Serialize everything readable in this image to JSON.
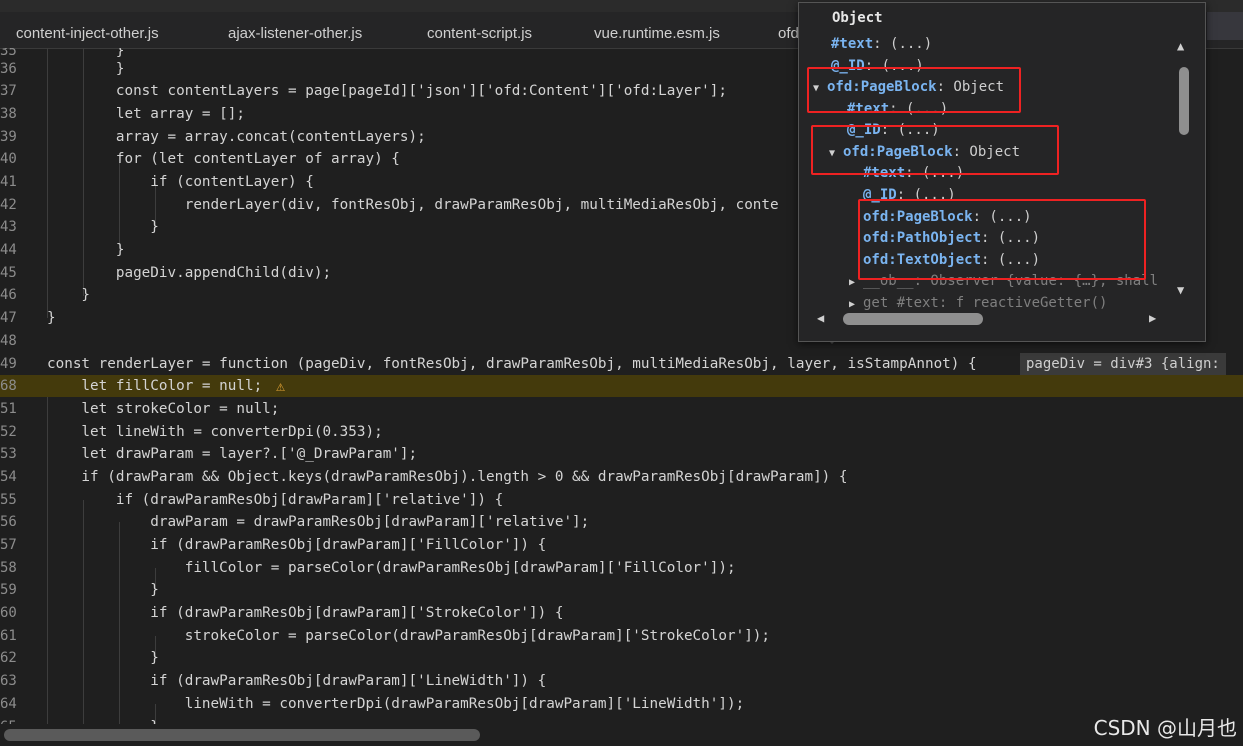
{
  "tabs": [
    {
      "label": "content-inject-other.js"
    },
    {
      "label": "ajax-listener-other.js"
    },
    {
      "label": "content-script.js"
    },
    {
      "label": "vue.runtime.esm.js"
    },
    {
      "label": "ofd"
    }
  ],
  "lines": [
    {
      "no": "35",
      "text": "        }"
    },
    {
      "no": "36",
      "text": "        }"
    },
    {
      "no": "37",
      "text": "        const contentLayers = page[pageId]['json']['ofd:Content']['ofd:Layer'];"
    },
    {
      "no": "38",
      "text": "        let array = [];"
    },
    {
      "no": "39",
      "text": "        array = array.concat(contentLayers);"
    },
    {
      "no": "40",
      "text": "        for (let contentLayer of array) {"
    },
    {
      "no": "41",
      "text": "            if (contentLayer) {"
    },
    {
      "no": "42",
      "text": "                renderLayer(div, fontResObj, drawParamResObj, multiMediaResObj, conte"
    },
    {
      "no": "43",
      "text": "            }"
    },
    {
      "no": "44",
      "text": "        }"
    },
    {
      "no": "45",
      "text": "        pageDiv.appendChild(div);"
    },
    {
      "no": "46",
      "text": "    }"
    },
    {
      "no": "47",
      "text": "}"
    },
    {
      "no": "48",
      "text": ""
    },
    {
      "no": "49",
      "text": "const renderLayer = function (pageDiv, fontResObj, drawParamResObj, multiMediaResObj, layer, isStampAnnot) {"
    },
    {
      "no": "68",
      "text": "    let fillColor = null;"
    },
    {
      "no": "51",
      "text": "    let strokeColor = null;"
    },
    {
      "no": "52",
      "text": "    let lineWith = converterDpi(0.353);"
    },
    {
      "no": "53",
      "text": "    let drawParam = layer?.['@_DrawParam'];"
    },
    {
      "no": "54",
      "text": "    if (drawParam && Object.keys(drawParamResObj).length > 0 && drawParamResObj[drawParam]) {"
    },
    {
      "no": "55",
      "text": "        if (drawParamResObj[drawParam]['relative']) {"
    },
    {
      "no": "56",
      "text": "            drawParam = drawParamResObj[drawParam]['relative'];"
    },
    {
      "no": "57",
      "text": "            if (drawParamResObj[drawParam]['FillColor']) {"
    },
    {
      "no": "58",
      "text": "                fillColor = parseColor(drawParamResObj[drawParam]['FillColor']);"
    },
    {
      "no": "59",
      "text": "            }"
    },
    {
      "no": "60",
      "text": "            if (drawParamResObj[drawParam]['StrokeColor']) {"
    },
    {
      "no": "61",
      "text": "                strokeColor = parseColor(drawParamResObj[drawParam]['StrokeColor']);"
    },
    {
      "no": "62",
      "text": "            }"
    },
    {
      "no": "63",
      "text": "            if (drawParamResObj[drawParam]['LineWidth']) {"
    },
    {
      "no": "64",
      "text": "                lineWith = converterDpi(drawParamResObj[drawParam]['LineWidth']);"
    },
    {
      "no": "65",
      "text": "            }"
    }
  ],
  "inline_hint": "pageDiv = div#3 {align:",
  "popup": {
    "title": "Object",
    "rows": [
      {
        "key": "#text",
        "val": ": (...)"
      },
      {
        "key": "@_ID",
        "val": ": (...)"
      },
      {
        "key": "ofd:PageBlock",
        "val": ": Object"
      },
      {
        "key": "#text",
        "val": ": (...)"
      },
      {
        "key": "@_ID",
        "val": ": (...)"
      },
      {
        "key": "ofd:PageBlock",
        "val": ": Object"
      },
      {
        "key": "#text",
        "val": ": (...)"
      },
      {
        "key": "@_ID",
        "val": ": (...)"
      },
      {
        "key": "ofd:PageBlock",
        "val": ": (...)"
      },
      {
        "key": "ofd:PathObject",
        "val": ": (...)"
      },
      {
        "key": "ofd:TextObject",
        "val": ": (...)"
      },
      {
        "key": "__ob__",
        "val": ": Observer {value: {…}, shall"
      },
      {
        "key": "get #text",
        "val": ": f reactiveGetter()"
      }
    ]
  },
  "watermark": "CSDN @山月也",
  "colors": {
    "highlight": "#443a0c",
    "redbox": "#ee2222",
    "key": "#7ab4f0"
  }
}
